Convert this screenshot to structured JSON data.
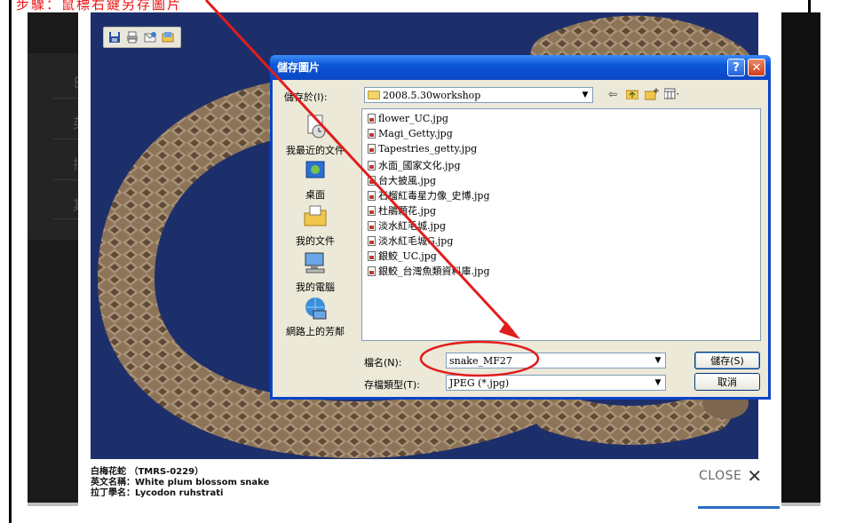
{
  "slide": {
    "top_note": "步驟：鼠標右鍵另存圖片"
  },
  "background_page": {
    "side_chars": [
      "日",
      "英",
      "拉",
      "其"
    ]
  },
  "photo_toolbar": {
    "icons": [
      "save-icon",
      "print-icon",
      "email-icon",
      "open-folder-icon"
    ]
  },
  "dialog": {
    "title": "儲存圖片",
    "help_button": "?",
    "close_button": "✕",
    "save_in_label": "儲存於(I):",
    "save_in_value": "2008.5.30workshop",
    "places": [
      {
        "label": "我最近的文件",
        "icon": "recent-documents-icon"
      },
      {
        "label": "桌面",
        "icon": "desktop-icon"
      },
      {
        "label": "我的文件",
        "icon": "my-documents-icon"
      },
      {
        "label": "我的電腦",
        "icon": "my-computer-icon"
      },
      {
        "label": "網路上的芳鄰",
        "icon": "network-places-icon"
      }
    ],
    "files": [
      "flower_UC.jpg",
      "Magi_Getty.jpg",
      "Tapestries_getty.jpg",
      "水面_國家文化.jpg",
      "台大披風.jpg",
      "石榴紅毒星力像_史博.jpg",
      "杜鵑顆花.jpg",
      "淡水紅毛城.jpg",
      "淡水紅毛城G.jpg",
      "銀鮫_UC.jpg",
      "銀鮫_台灣魚類資料庫.jpg"
    ],
    "filename_label": "檔名(N):",
    "filename_value": "snake_MF27",
    "filetype_label": "存檔類型(T):",
    "filetype_value": "JPEG (*.jpg)",
    "save_button": "儲存(S)",
    "cancel_button": "取消"
  },
  "caption": {
    "line1": "白梅花蛇 （TMRS-0229）",
    "line2": "英文名稱：White plum blossom snake",
    "line3": "拉丁學名：Lycodon ruhstrati"
  },
  "close_label": "CLOSE",
  "colors": {
    "annotation": "#e11d1d",
    "xp_title_blue": "#0a47c4",
    "photo_bg": "#1d2f6b"
  }
}
